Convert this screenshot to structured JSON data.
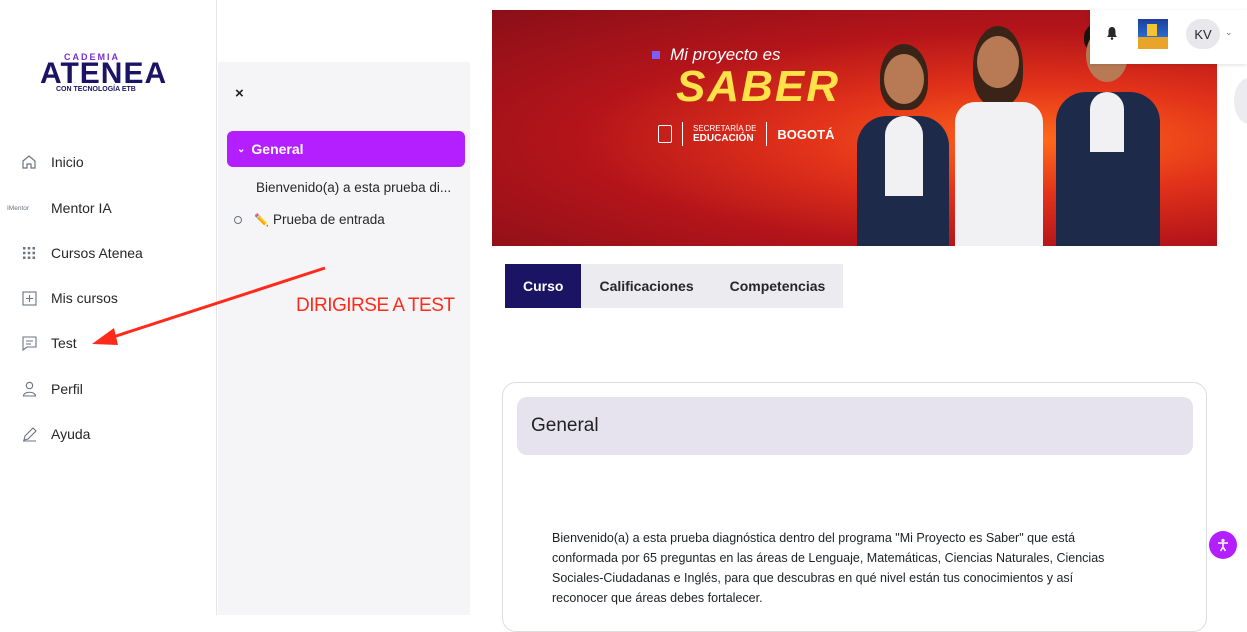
{
  "logo": {
    "top": "CADEMIA",
    "big": "ATENEA",
    "sub": "CON TECNOLOGÍA ETB"
  },
  "nav": {
    "items": [
      {
        "label": "Inicio",
        "icon": "home-icon"
      },
      {
        "label": "Mentor IA",
        "icon_text": "IMentor"
      },
      {
        "label": "Cursos Atenea",
        "icon": "grid-icon"
      },
      {
        "label": "Mis cursos",
        "icon": "plus-square-icon"
      },
      {
        "label": "Test",
        "icon": "message-icon"
      },
      {
        "label": "Perfil",
        "icon": "user-icon"
      },
      {
        "label": "Ayuda",
        "icon": "pencil-icon"
      }
    ]
  },
  "drawer": {
    "close": "×",
    "section": "General",
    "item1": "Bienvenido(a) a esta prueba di...",
    "item2": "Prueba de entrada"
  },
  "annotation": {
    "text": "DIRIGIRSE A TEST",
    "color": "#ff2a1a"
  },
  "banner": {
    "line1": "Mi proyecto es",
    "line2": "SABER",
    "secretaria": "SECRETARÍA DE",
    "educacion": "EDUCACIÓN",
    "bogota": "BOGOTÁ"
  },
  "tabs": [
    {
      "label": "Curso",
      "active": true
    },
    {
      "label": "Calificaciones",
      "active": false
    },
    {
      "label": "Competencias",
      "active": false
    }
  ],
  "card": {
    "title": "General",
    "description": "Bienvenido(a) a esta prueba diagnóstica dentro del programa \"Mi Proyecto es Saber\" que está conformada por 65 preguntas en las áreas de Lenguaje, Matemáticas, Ciencias Naturales, Ciencias Sociales-Ciudadanas e Inglés, para que descubras en qué nivel están tus conocimientos y así reconocer que áreas debes fortalecer."
  },
  "user": {
    "initials": "KV"
  },
  "colors": {
    "accent": "#b31fff",
    "brand_navy": "#1b1464"
  }
}
